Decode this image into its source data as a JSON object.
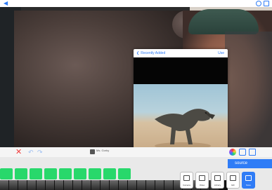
{
  "picker": {
    "back_label": "Recently Added",
    "use_label": "Use"
  },
  "toolbar": {
    "layer_label": "Ms. Gorky"
  },
  "source": {
    "label": "source",
    "buttons": [
      {
        "name": "camera",
        "label": "Camera"
      },
      {
        "name": "video",
        "label": "Video"
      },
      {
        "name": "library",
        "label": "Library"
      },
      {
        "name": "gif",
        "label": "GIF"
      },
      {
        "name": "store",
        "label": "Store"
      }
    ]
  },
  "colors": {
    "accent": "#2f7cf6",
    "track_green": "#28d86b",
    "delete_red": "#f23b3b"
  }
}
